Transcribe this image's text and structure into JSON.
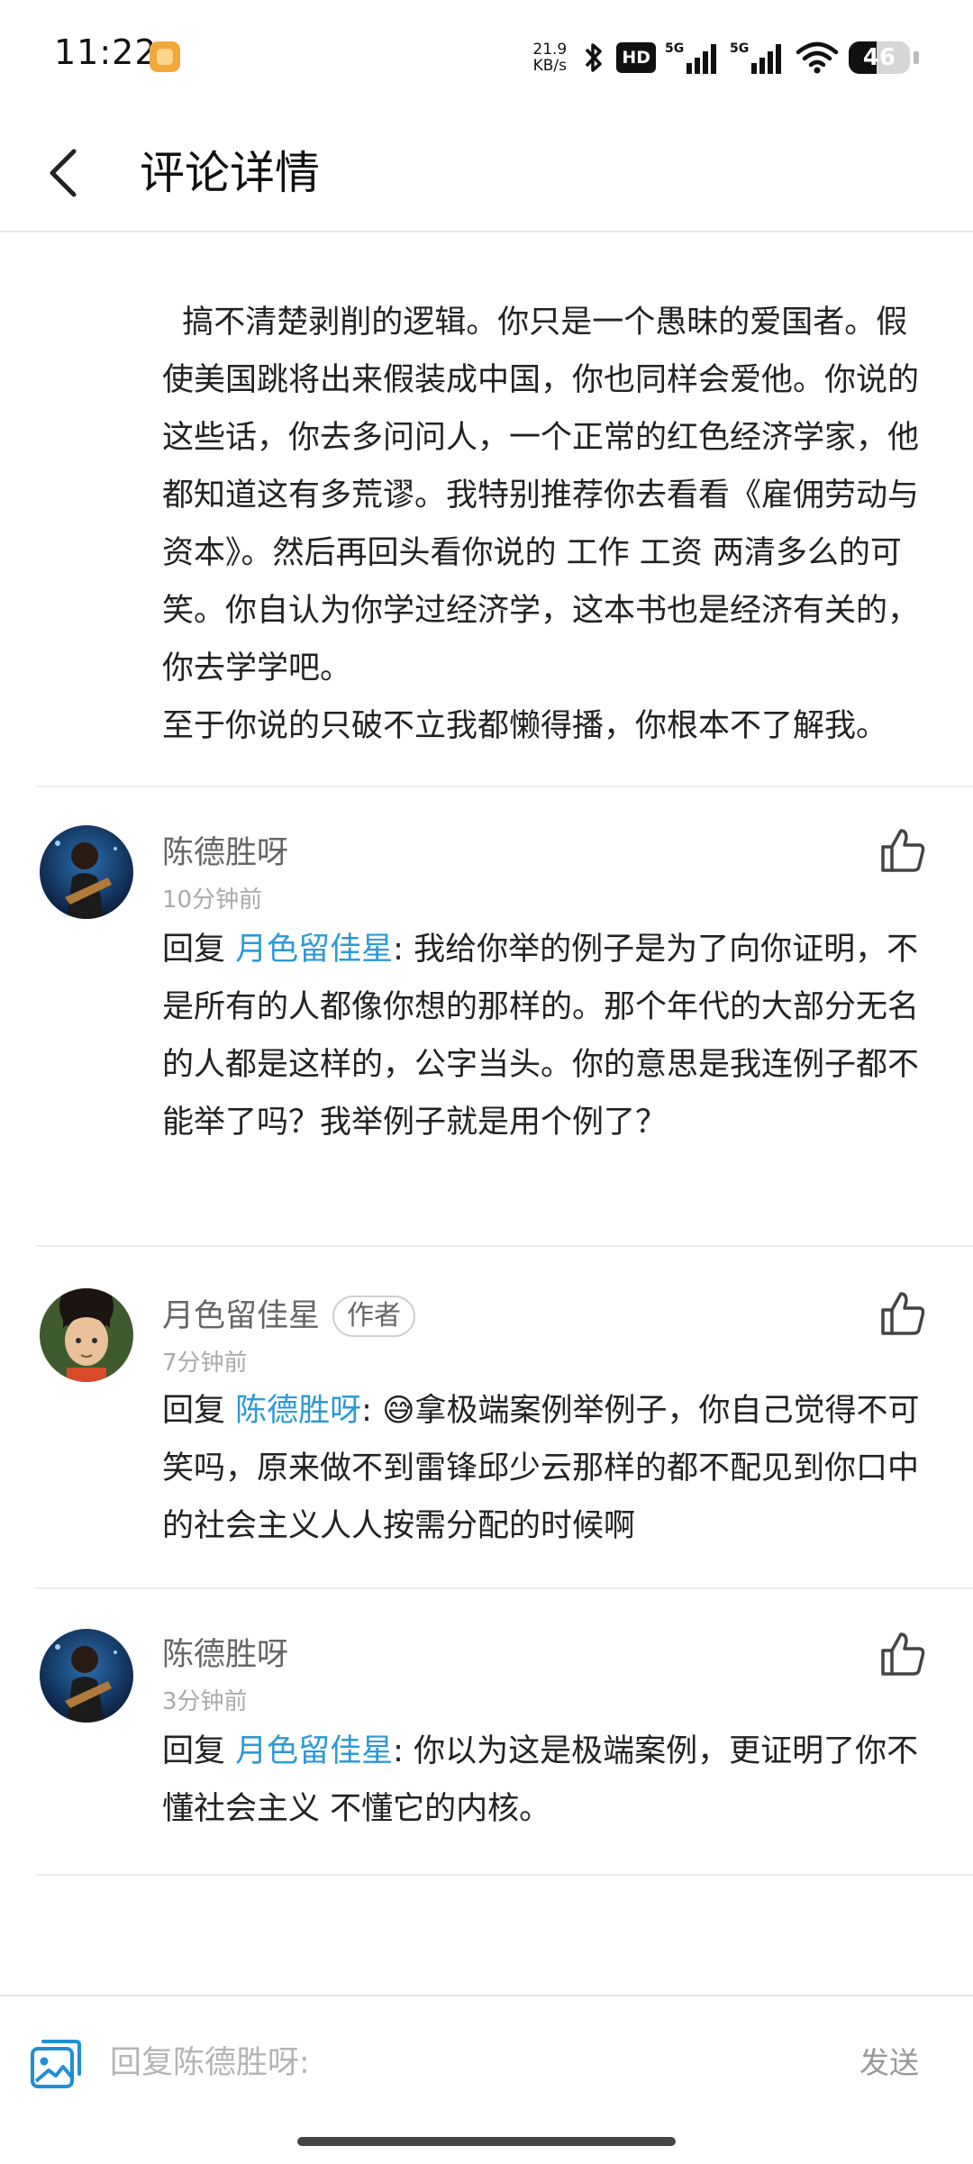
{
  "status_bar": {
    "time": "11:22",
    "net_speed_value": "21.9",
    "net_speed_unit": "KB/s",
    "hd_label": "HD",
    "battery": "46",
    "battery_level": 0.46
  },
  "header": {
    "title": "评论详情"
  },
  "top_comment": {
    "text": "搞不清楚剥削的逻辑。你只是一个愚昧的爱国者。假使美国跳将出来假装成中国，你也同样会爱他。你说的这些话，你去多问问人，一个正常的红色经济学家，他都知道这有多荒谬。我特别推荐你去看看《雇佣劳动与资本》。然后再回头看你说的 工作 工资 两清多么的可笑。你自认为你学过经济学，这本书也是经济有关的，你去学学吧。\n至于你说的只破不立我都懒得播，你根本不了解我。"
  },
  "comments": [
    {
      "name": "陈德胜呀",
      "time": "10分钟前",
      "reply_prefix": "回复 ",
      "reply_to": "月色留佳星",
      "text": ": 我给你举的例子是为了向你证明，不是所有的人都像你想的那样的。那个年代的大部分无名的人都是这样的，公字当头。你的意思是我连例子都不能举了吗？我举例子就是用个例了？"
    },
    {
      "name": "月色留佳星",
      "badge": "作者",
      "time": "7分钟前",
      "reply_prefix": "回复 ",
      "reply_to": "陈德胜呀",
      "text": ": 😅拿极端案例举例子，你自己觉得不可笑吗，原来做不到雷锋邱少云那样的都不配见到你口中的社会主义人人按需分配的时候啊"
    },
    {
      "name": "陈德胜呀",
      "time": "3分钟前",
      "reply_prefix": "回复 ",
      "reply_to": "月色留佳星",
      "text": ": 你以为这是极端案例，更证明了你不懂社会主义 不懂它的内核。"
    }
  ],
  "bottom_bar": {
    "placeholder": "回复陈德胜呀:",
    "value": "",
    "send_label": "发送"
  },
  "colors": {
    "mention": "#2b9ad6",
    "icon_blue": "#1e8fd6"
  },
  "icons": {
    "back": "chevron-left-icon",
    "like": "thumbs-up-icon",
    "image": "image-icon"
  }
}
